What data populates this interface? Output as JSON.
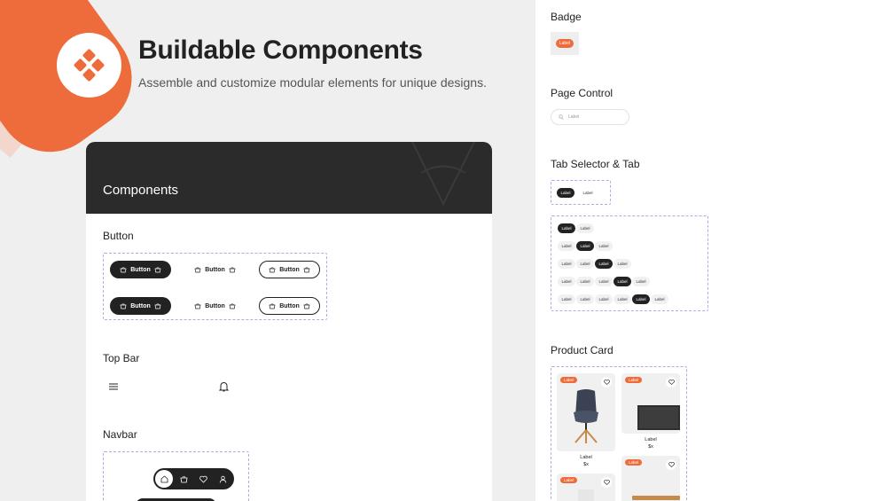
{
  "hero": {
    "title": "Buildable Components",
    "subtitle": "Assemble and customize modular elements for unique designs."
  },
  "components": {
    "header": "Components",
    "button_section": "Button",
    "button_label": "Button",
    "topbar_section": "Top Bar",
    "navbar_section": "Navbar"
  },
  "right": {
    "badge_section": "Badge",
    "badge_label": "Label",
    "page_control_section": "Page Control",
    "search_placeholder": "Label",
    "tab_section": "Tab Selector & Tab",
    "tab_label": "Label",
    "product_section": "Product Card",
    "product": {
      "badge": "Label",
      "name": "Label",
      "price": "$x"
    }
  },
  "colors": {
    "accent": "#ee6c3b",
    "dark": "#222222",
    "dashed": "#b8a7e6"
  },
  "icons": [
    "logo-diamond-icon",
    "basket-icon",
    "menu-icon",
    "bell-icon",
    "home-icon",
    "bag-icon",
    "heart-icon",
    "user-icon",
    "search-icon"
  ]
}
